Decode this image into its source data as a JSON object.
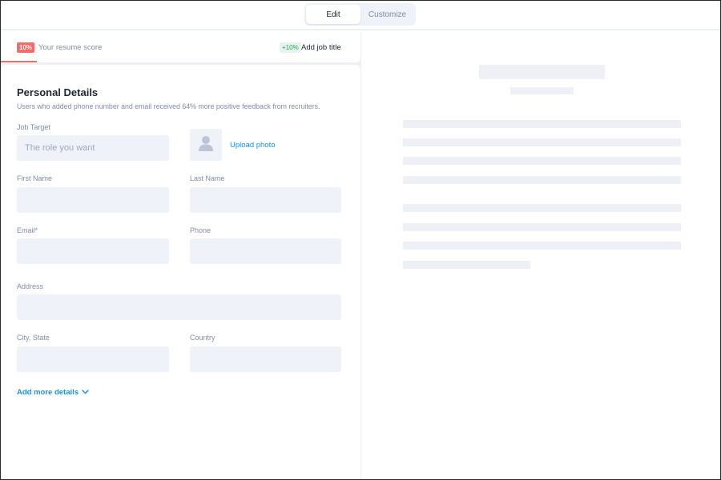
{
  "tabs": {
    "edit": "Edit",
    "customize": "Customize"
  },
  "score": {
    "badge": "10%",
    "label": "Your resume score",
    "progress": 0.1,
    "tip_badge": "+10%",
    "tip_label": "Add job title"
  },
  "section": {
    "title": "Personal Details",
    "subtitle": "Users who added phone number and email received 64% more positive feedback from recruiters."
  },
  "fields": {
    "job_target": {
      "label": "Job Target",
      "placeholder": "The role you want",
      "value": ""
    },
    "first_name": {
      "label": "First Name",
      "value": ""
    },
    "last_name": {
      "label": "Last Name",
      "value": ""
    },
    "email": {
      "label": "Email*",
      "value": ""
    },
    "phone": {
      "label": "Phone",
      "value": ""
    },
    "address": {
      "label": "Address",
      "value": ""
    },
    "city_state": {
      "label": "City, State",
      "value": ""
    },
    "country": {
      "label": "Country",
      "value": ""
    }
  },
  "photo": {
    "upload_label": "Upload photo",
    "icon": "user-silhouette-icon"
  },
  "more": {
    "label": "Add more details",
    "icon": "chevron-down-icon"
  },
  "colors": {
    "accent": "#1a91f0",
    "score_badge": "#f26c6c",
    "tip_badge_bg": "#e7f4ed",
    "tip_badge_text": "#339d5d",
    "input_bg": "#eff2f9"
  }
}
